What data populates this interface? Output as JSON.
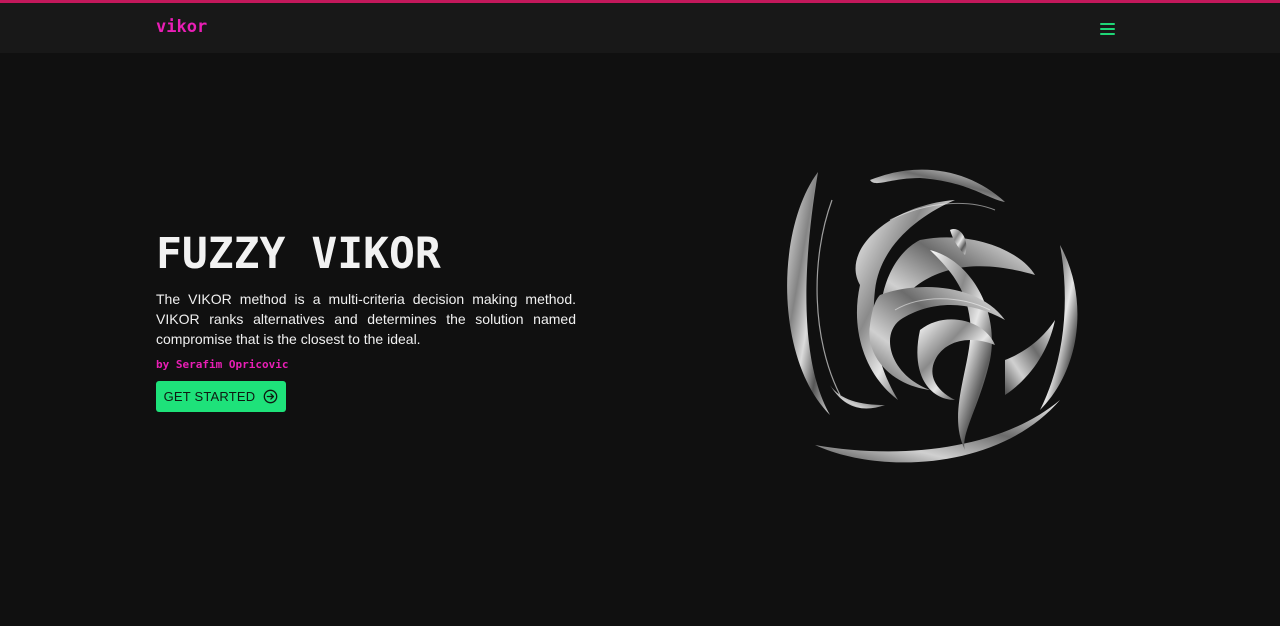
{
  "header": {
    "brand": "vikor",
    "menu_icon": "hamburger-menu-icon"
  },
  "hero": {
    "title": "FUZZY VIKOR",
    "description": "The VIKOR method is a multi-criteria decision making method. VIKOR ranks alternatives and determines the solution named compromise that is the closest to the ideal.",
    "author": "by Serafim Opricovic",
    "cta_label": "GET STARTED",
    "cta_icon": "arrow-right-circle-icon",
    "illustration": "chrome-abstract-swirl-graphic"
  },
  "colors": {
    "accent_pink": "#e91eb5",
    "accent_green": "#1ee27a",
    "top_bar": "#c2185b",
    "background": "#101010",
    "navbar": "#181818"
  }
}
